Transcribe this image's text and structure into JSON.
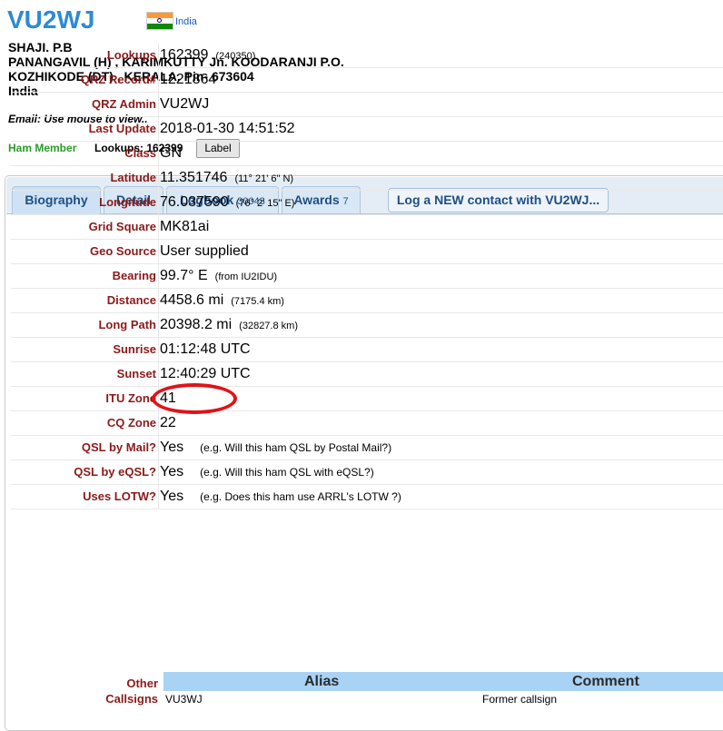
{
  "header": {
    "callsign": "VU2WJ",
    "country": "India",
    "name": "SHAJI. P.B",
    "address_line1": "PANANGAVIL (H) , KARIMKUTTY Jn. KOODARANJI P.O.",
    "address_line2": "KOZHIKODE (DT) , KERALA. Pin- 673604",
    "address_country": "India",
    "email_text": "Email: Use mouse to view..",
    "member_text": "Ham Member",
    "lookups_text": "Lookups: 162399",
    "label_button": "Label"
  },
  "tabs": [
    {
      "label": "Biography",
      "count": ""
    },
    {
      "label": "Detail",
      "count": ""
    },
    {
      "label": "Logbook",
      "count": "30043"
    },
    {
      "label": "Awards",
      "count": "7"
    }
  ],
  "log_contact_button": "Log a NEW contact with VU2WJ...",
  "rows": {
    "lookups": {
      "label": "Lookups",
      "value": "162399",
      "sub": "(240350)"
    },
    "qrz_record": {
      "label": "QRZ Record#",
      "value": "1221864"
    },
    "qrz_admin": {
      "label": "QRZ Admin",
      "value": "VU2WJ"
    },
    "last_update": {
      "label": "Last Update",
      "value": "2018-01-30 14:51:52"
    },
    "class": {
      "label": "Class",
      "value": "GN"
    },
    "latitude": {
      "label": "Latitude",
      "value": "11.351746",
      "sub": "(11° 21' 6\" N)"
    },
    "longitude": {
      "label": "Longitude",
      "value": "76.037590",
      "sub": "(76° 2' 15\" E)"
    },
    "grid_square": {
      "label": "Grid Square",
      "value": "MK81ai"
    },
    "geo_source": {
      "label": "Geo Source",
      "value": "User supplied"
    },
    "bearing": {
      "label": "Bearing",
      "value": "99.7° E",
      "sub": "(from IU2IDU)"
    },
    "distance": {
      "label": "Distance",
      "value": "4458.6 mi",
      "sub": "(7175.4 km)"
    },
    "long_path": {
      "label": "Long Path",
      "value": "20398.2 mi",
      "sub": "(32827.8 km)"
    },
    "sunrise": {
      "label": "Sunrise",
      "value": "01:12:48 UTC"
    },
    "sunset": {
      "label": "Sunset",
      "value": "12:40:29 UTC"
    },
    "itu_zone": {
      "label": "ITU Zone",
      "value": "41"
    },
    "cq_zone": {
      "label": "CQ Zone",
      "value": "22"
    },
    "qsl_mail": {
      "label": "QSL by Mail?",
      "value": "Yes",
      "note": "(e.g. Will this ham QSL by Postal Mail?)"
    },
    "qsl_eqsl": {
      "label": "QSL by eQSL?",
      "value": "Yes",
      "note": "(e.g. Will this ham QSL with eQSL?)"
    },
    "uses_lotw": {
      "label": "Uses LOTW?",
      "value": "Yes",
      "note": "(e.g. Does this ham use ARRL's LOTW ?)"
    }
  },
  "other_callsigns": {
    "label_line1": "Other",
    "label_line2": "Callsigns",
    "col_alias": "Alias",
    "col_comment": "Comment",
    "alias": "VU3WJ",
    "comment": "Former callsign"
  },
  "colors": {
    "callsign": "#2e8bd0",
    "field_label": "#8b1a1a",
    "highlight_circle": "#e0131a"
  }
}
